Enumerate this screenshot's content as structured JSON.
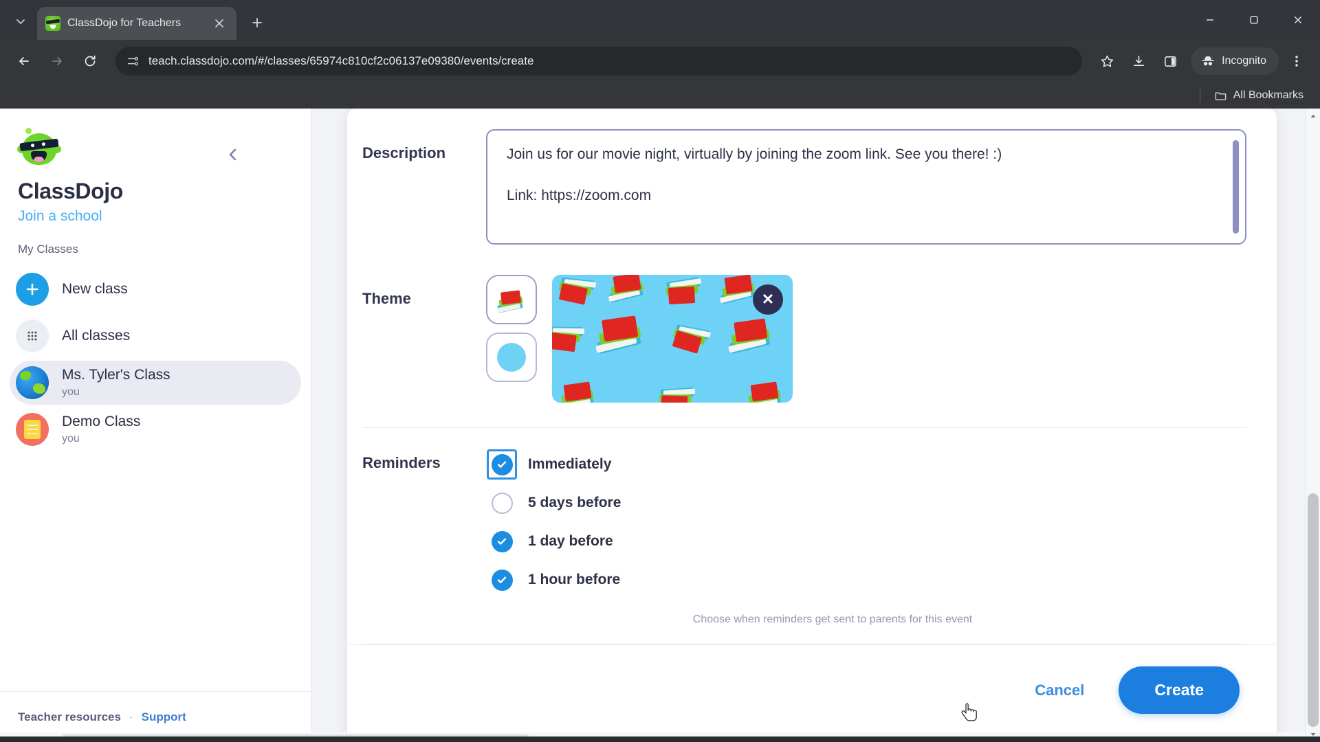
{
  "browser": {
    "tab": {
      "title": "ClassDojo for Teachers",
      "favicon": "classdojo-favicon",
      "close_label": "×"
    },
    "tablist_icon": "chevron-down-icon",
    "newtab_label": "+",
    "window_controls": {
      "minimize": "—",
      "maximize": "❑",
      "close": "✕"
    },
    "nav": {
      "back": "←",
      "forward": "→",
      "reload": "⟳"
    },
    "omnibox": {
      "url": "teach.classdojo.com/#/classes/65974c810cf2c06137e09380/events/create",
      "site_icon": "site-settings-icon"
    },
    "toolbar_icons": [
      "bookmark-star-icon",
      "downloads-icon",
      "side-panel-icon",
      "more-menu-icon"
    ],
    "incognito_label": "Incognito",
    "bookmarks_bar": {
      "all_bookmarks_label": "All Bookmarks",
      "folder_icon": "folder-icon"
    }
  },
  "sidebar": {
    "brand": "ClassDojo",
    "join_school": "Join a school",
    "collapse_icon": "chevron-left-icon",
    "section_label": "My Classes",
    "items": [
      {
        "title": "New class",
        "sub": "",
        "icon": "plus-icon",
        "active": false
      },
      {
        "title": "All classes",
        "sub": "",
        "icon": "grid-icon",
        "active": false
      },
      {
        "title": "Ms. Tyler's Class",
        "sub": "you",
        "icon": "globe-icon",
        "active": true
      },
      {
        "title": "Demo Class",
        "sub": "you",
        "icon": "notebook-icon",
        "active": false
      }
    ],
    "footer": {
      "teacher_resources": "Teacher resources",
      "separator": "·",
      "support": "Support"
    }
  },
  "form": {
    "description": {
      "label": "Description",
      "line1": "Join us for our movie night, virtually by joining the zoom link. See you there! :)",
      "line2": "Link: https://zoom.com"
    },
    "theme": {
      "label": "Theme",
      "tiles": [
        {
          "name": "books-sticker-tile",
          "selected": true
        },
        {
          "name": "color-swatch-tile",
          "selected": false
        }
      ],
      "preview_close_label": "✕",
      "preview_background_color": "#6ed2f7"
    },
    "reminders": {
      "label": "Reminders",
      "options": [
        {
          "label": "Immediately",
          "checked": true,
          "focused": true
        },
        {
          "label": "5 days before",
          "checked": false,
          "focused": false
        },
        {
          "label": "1 day before",
          "checked": true,
          "focused": false
        },
        {
          "label": "1 hour before",
          "checked": true,
          "focused": false
        }
      ],
      "hint": "Choose when reminders get sent to parents for this event"
    }
  },
  "footer": {
    "cancel_label": "Cancel",
    "create_label": "Create"
  },
  "colors": {
    "accent_blue": "#1c7fe0",
    "link_blue": "#45aff7",
    "theme_blue": "#6ed2f7",
    "text_dark": "#2d3148"
  }
}
